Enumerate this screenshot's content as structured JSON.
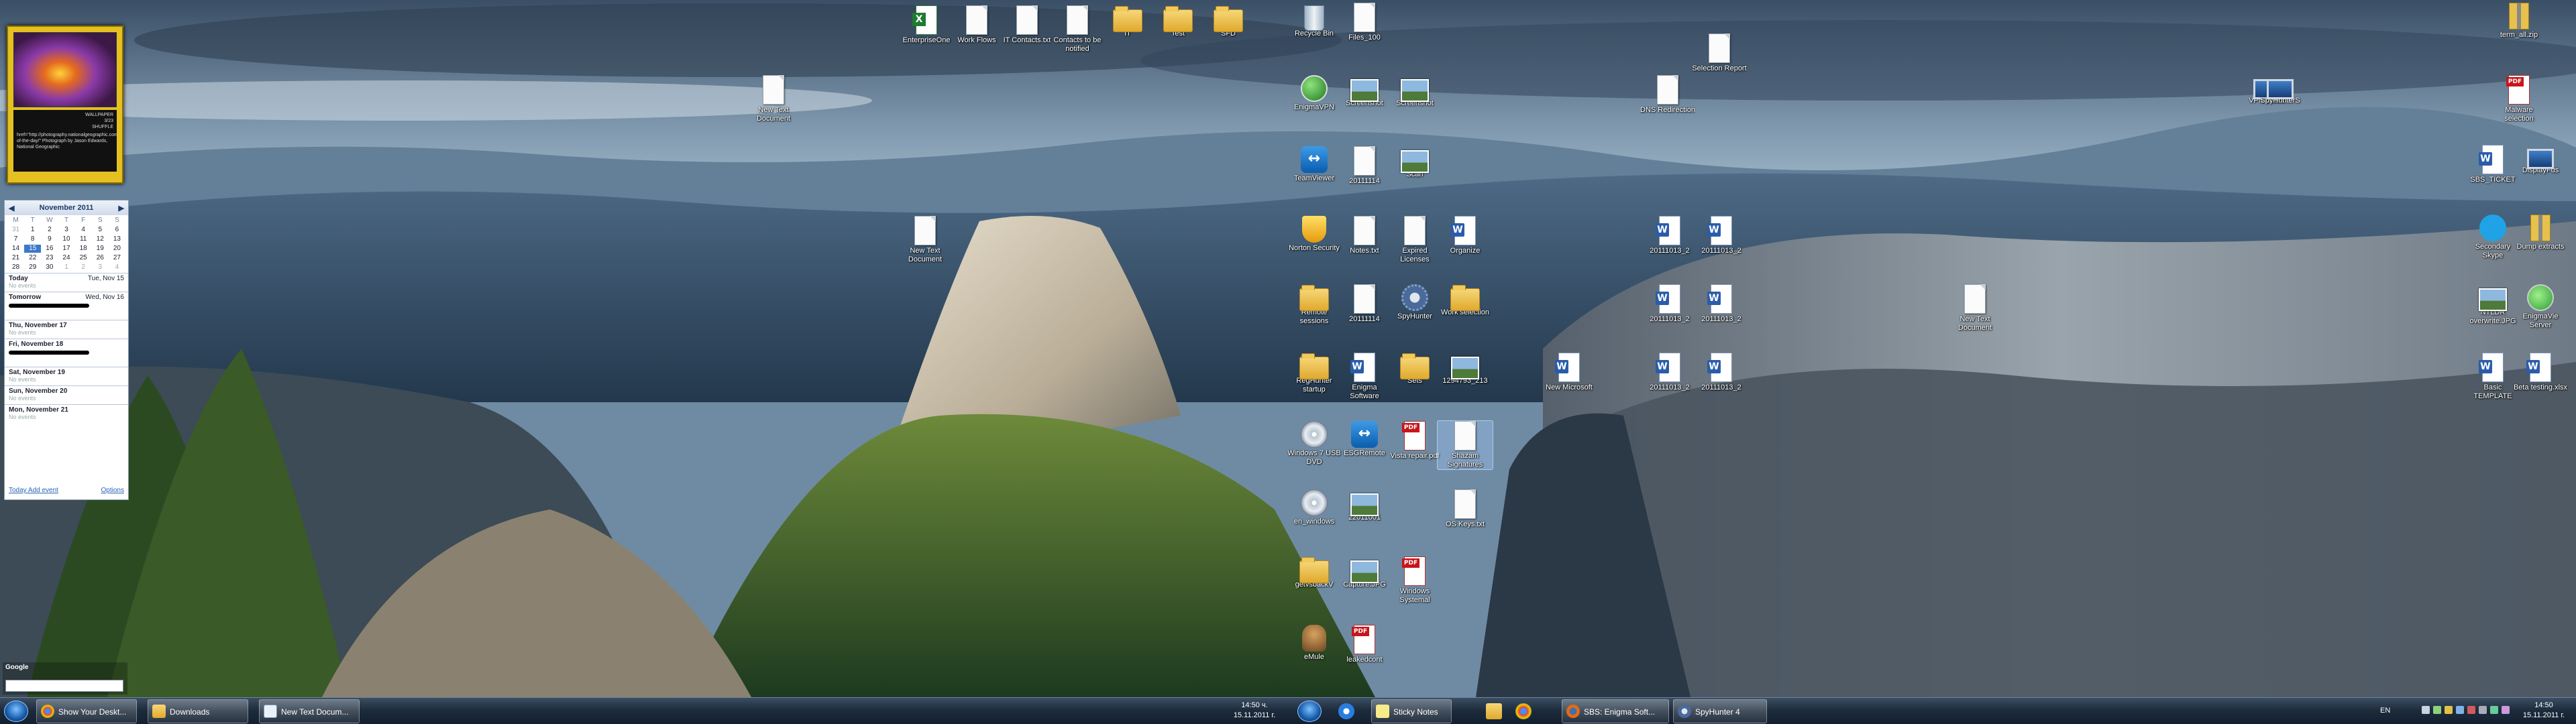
{
  "colors": {
    "taskbar": "#1c2a3a",
    "gadget_frame": "#e4c021",
    "calendar_accent": "#3b78c9"
  },
  "photo_gadget": {
    "label_1": "WALLPAPER",
    "value_1": "3/23",
    "label_2": "SHUFFLE",
    "caption": "href=\"http://photography.nationalgeographic.com/photography/photo-of-the-day/\" Photograph by Jason Edwards, National Geographic"
  },
  "calendar": {
    "month": "November 2011",
    "weekdays": [
      "M",
      "T",
      "W",
      "T",
      "F",
      "S",
      "S"
    ],
    "cells": [
      {
        "t": "31",
        "c": "mut"
      },
      {
        "t": "1",
        "c": ""
      },
      {
        "t": "2",
        "c": ""
      },
      {
        "t": "3",
        "c": ""
      },
      {
        "t": "4",
        "c": ""
      },
      {
        "t": "5",
        "c": ""
      },
      {
        "t": "6",
        "c": ""
      },
      {
        "t": "7",
        "c": ""
      },
      {
        "t": "8",
        "c": ""
      },
      {
        "t": "9",
        "c": ""
      },
      {
        "t": "10",
        "c": ""
      },
      {
        "t": "11",
        "c": ""
      },
      {
        "t": "12",
        "c": ""
      },
      {
        "t": "13",
        "c": ""
      },
      {
        "t": "14",
        "c": ""
      },
      {
        "t": "15",
        "c": "today"
      },
      {
        "t": "16",
        "c": ""
      },
      {
        "t": "17",
        "c": ""
      },
      {
        "t": "18",
        "c": ""
      },
      {
        "t": "19",
        "c": ""
      },
      {
        "t": "20",
        "c": ""
      },
      {
        "t": "21",
        "c": ""
      },
      {
        "t": "22",
        "c": ""
      },
      {
        "t": "23",
        "c": ""
      },
      {
        "t": "24",
        "c": ""
      },
      {
        "t": "25",
        "c": ""
      },
      {
        "t": "26",
        "c": ""
      },
      {
        "t": "27",
        "c": ""
      },
      {
        "t": "28",
        "c": ""
      },
      {
        "t": "29",
        "c": ""
      },
      {
        "t": "30",
        "c": ""
      },
      {
        "t": "1",
        "c": "mut"
      },
      {
        "t": "2",
        "c": "mut"
      },
      {
        "t": "3",
        "c": "mut"
      },
      {
        "t": "4",
        "c": "mut"
      }
    ],
    "days": [
      {
        "name": "Today",
        "date": "Tue, Nov 15",
        "note": "No events",
        "redacted": false
      },
      {
        "name": "Tomorrow",
        "date": "Wed, Nov 16",
        "note": "",
        "redacted": true
      },
      {
        "name": "Thu, November 17",
        "date": "",
        "note": "No events",
        "redacted": false
      },
      {
        "name": "Fri, November 18",
        "date": "",
        "note": "",
        "redacted": true
      },
      {
        "name": "Sat, November 19",
        "date": "",
        "note": "No events",
        "redacted": false
      },
      {
        "name": "Sun, November 20",
        "date": "",
        "note": "No events",
        "redacted": false
      },
      {
        "name": "Mon, November 21",
        "date": "",
        "note": "No events",
        "redacted": false
      }
    ],
    "add_event": "Today Add event",
    "options": "Options"
  },
  "search_gadget": {
    "brand": "Google"
  },
  "desktop_icons": [
    {
      "label": "EnterpriseOne",
      "type": "excel"
    },
    {
      "label": "Work Flows",
      "type": "file"
    },
    {
      "label": "IT Contacts.txt",
      "type": "file"
    },
    {
      "label": "Contacts to be notified",
      "type": "file"
    },
    {
      "label": "IT",
      "type": "folder"
    },
    {
      "label": "Test",
      "type": "folder"
    },
    {
      "label": "SFD",
      "type": "folder"
    },
    {
      "label": "Recycle Bin",
      "type": "bin"
    },
    {
      "label": "Files_100",
      "type": "file"
    },
    {
      "label": "Selection Report",
      "type": "file"
    },
    {
      "label": "New Text Document",
      "type": "file"
    },
    {
      "label": "EnigmaVPN",
      "type": "round"
    },
    {
      "label": "Screenshot",
      "type": "img"
    },
    {
      "label": "Screenshot",
      "type": "img"
    },
    {
      "label": "DNS Redirection",
      "type": "file"
    },
    {
      "label": "VPN Client",
      "type": "monitor"
    },
    {
      "label": "TeamViewer",
      "type": "tv"
    },
    {
      "label": "20111114",
      "type": "file"
    },
    {
      "label": "Scan",
      "type": "img"
    },
    {
      "label": "New Text Document",
      "type": "file"
    },
    {
      "label": "Norton Security",
      "type": "shield"
    },
    {
      "label": "Notes.txt",
      "type": "file"
    },
    {
      "label": "Expired Licenses",
      "type": "file"
    },
    {
      "label": "Organize",
      "type": "word"
    },
    {
      "label": "Remote sessions",
      "type": "folder"
    },
    {
      "label": "20111114",
      "type": "file"
    },
    {
      "label": "SpyHunter",
      "type": "gear"
    },
    {
      "label": "Work selection",
      "type": "folder"
    },
    {
      "label": "RegHunter startup",
      "type": "folder"
    },
    {
      "label": "Enigma Software",
      "type": "word"
    },
    {
      "label": "Sets",
      "type": "folder"
    },
    {
      "label": "1294793_213",
      "type": "img"
    },
    {
      "label": "Windows 7 USB DVD",
      "type": "disc"
    },
    {
      "label": "ESGRemote",
      "type": "tv"
    },
    {
      "label": "Vista repair.pdf",
      "type": "pdf"
    },
    {
      "label": "Shazam Signatures",
      "type": "file"
    },
    {
      "label": "en_windows",
      "type": "disc"
    },
    {
      "label": "22011001",
      "type": "img"
    },
    {
      "label": "OS Keys.txt",
      "type": "file"
    },
    {
      "label": "getvsbackV",
      "type": "folder"
    },
    {
      "label": "Capture.JPG",
      "type": "img"
    },
    {
      "label": "Windows Systemal",
      "type": "pdf"
    },
    {
      "label": "eMule",
      "type": "mule"
    },
    {
      "label": "leakedcont",
      "type": "pdf"
    },
    {
      "label": "20111013_2",
      "type": "word"
    },
    {
      "label": "20111013_2",
      "type": "word"
    },
    {
      "label": "20111013_2",
      "type": "word"
    },
    {
      "label": "20111013_2",
      "type": "word"
    },
    {
      "label": "20111013_2",
      "type": "word"
    },
    {
      "label": "20111013_2",
      "type": "word"
    },
    {
      "label": "New Microsoft",
      "type": "word"
    },
    {
      "label": "New Text Document",
      "type": "file"
    },
    {
      "label": "term_all.zip",
      "type": "zip"
    },
    {
      "label": "SpyHunterS",
      "type": "monitor"
    },
    {
      "label": "Malware selection",
      "type": "pdf"
    },
    {
      "label": "SBS_TICKET",
      "type": "word"
    },
    {
      "label": "DisplayFus",
      "type": "monitor"
    },
    {
      "label": "Secondary Skype",
      "type": "skype"
    },
    {
      "label": "Dump extracts",
      "type": "zip"
    },
    {
      "label": "NTLDR overwrite.JPG",
      "type": "img"
    },
    {
      "label": "EnigmaVie Server",
      "type": "net"
    },
    {
      "label": "Basic TEMPLATE",
      "type": "word"
    },
    {
      "label": "Beta testing.xlsx",
      "type": "word"
    }
  ],
  "taskbar_left": {
    "windows": [
      "Show Your Deskt...",
      "Downloads",
      "New Text Docum..."
    ],
    "time": "14:50 ч.",
    "date": "15.11.2011 г."
  },
  "taskbar_right": {
    "windows": [
      "Sticky Notes",
      "SBS: Enigma Soft...",
      "SpyHunter 4"
    ],
    "lang": "EN",
    "time": "14:50",
    "date": "15.11.2011 г."
  }
}
